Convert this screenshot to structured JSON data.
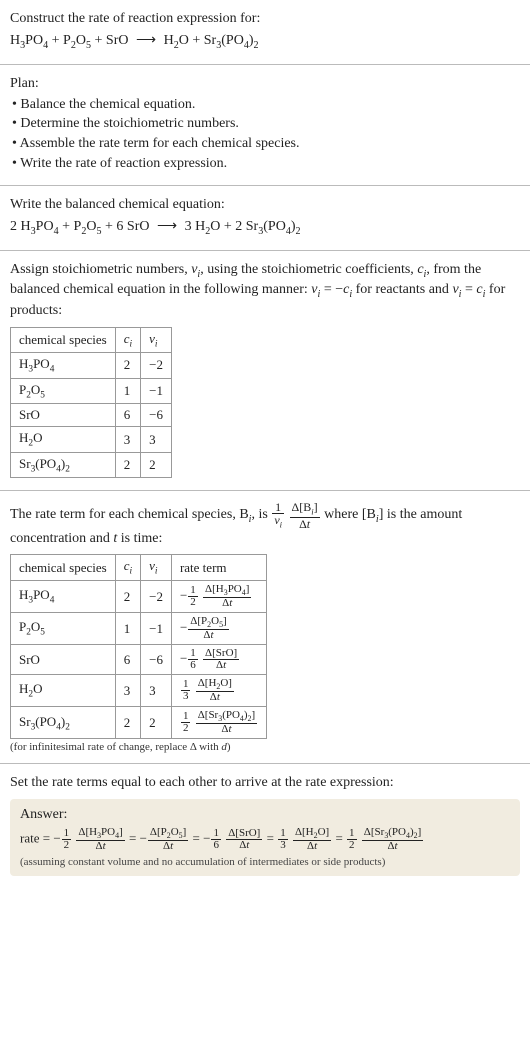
{
  "intro": {
    "title": "Construct the rate of reaction expression for:",
    "equation_html": "H<span class='sub'>3</span>PO<span class='sub'>4</span> + P<span class='sub'>2</span>O<span class='sub'>5</span> + SrO <span class='arrow'>⟶</span> H<span class='sub'>2</span>O + Sr<span class='sub'>3</span>(PO<span class='sub'>4</span>)<span class='sub'>2</span>"
  },
  "plan": {
    "title": "Plan:",
    "items": [
      "• Balance the chemical equation.",
      "• Determine the stoichiometric numbers.",
      "• Assemble the rate term for each chemical species.",
      "• Write the rate of reaction expression."
    ]
  },
  "balanced": {
    "title": "Write the balanced chemical equation:",
    "equation_html": "2 H<span class='sub'>3</span>PO<span class='sub'>4</span> + P<span class='sub'>2</span>O<span class='sub'>5</span> + 6 SrO <span class='arrow'>⟶</span> 3 H<span class='sub'>2</span>O + 2 Sr<span class='sub'>3</span>(PO<span class='sub'>4</span>)<span class='sub'>2</span>"
  },
  "stoich": {
    "intro_html": "Assign stoichiometric numbers, <span class='ital'>ν<span class='sub'>i</span></span>, using the stoichiometric coefficients, <span class='ital'>c<span class='sub'>i</span></span>, from the balanced chemical equation in the following manner: <span class='ital'>ν<span class='sub'>i</span></span> = −<span class='ital'>c<span class='sub'>i</span></span> for reactants and <span class='ital'>ν<span class='sub'>i</span></span> = <span class='ital'>c<span class='sub'>i</span></span> for products:",
    "headers": {
      "species": "chemical species",
      "ci_html": "<span class='ital'>c<span class='sub'>i</span></span>",
      "vi_html": "<span class='ital'>ν<span class='sub'>i</span></span>"
    },
    "rows": [
      {
        "species_html": "H<span class='sub'>3</span>PO<span class='sub'>4</span>",
        "c": "2",
        "v": "−2"
      },
      {
        "species_html": "P<span class='sub'>2</span>O<span class='sub'>5</span>",
        "c": "1",
        "v": "−1"
      },
      {
        "species_html": "SrO",
        "c": "6",
        "v": "−6"
      },
      {
        "species_html": "H<span class='sub'>2</span>O",
        "c": "3",
        "v": "3"
      },
      {
        "species_html": "Sr<span class='sub'>3</span>(PO<span class='sub'>4</span>)<span class='sub'>2</span>",
        "c": "2",
        "v": "2"
      }
    ]
  },
  "rateterm": {
    "intro_html": "The rate term for each chemical species, B<span class='sub ital'>i</span>, is <span class='frac'><span class='num'>1</span><span class='den ital'>ν<span class='sub'>i</span></span></span> <span class='frac'><span class='num'>Δ[B<span class='sub ital'>i</span>]</span><span class='den'>Δ<span class='ital'>t</span></span></span> where [B<span class='sub ital'>i</span>] is the amount concentration and <span class='ital'>t</span> is time:",
    "headers": {
      "species": "chemical species",
      "ci_html": "<span class='ital'>c<span class='sub'>i</span></span>",
      "vi_html": "<span class='ital'>ν<span class='sub'>i</span></span>",
      "rate": "rate term"
    },
    "rows": [
      {
        "species_html": "H<span class='sub'>3</span>PO<span class='sub'>4</span>",
        "c": "2",
        "v": "−2",
        "rate_html": "−<span class='frac sfrac'><span class='num'>1</span><span class='den'>2</span></span> <span class='frac sfrac'><span class='num'>Δ[H<span class='sub'>3</span>PO<span class='sub'>4</span>]</span><span class='den'>Δ<span class='ital'>t</span></span></span>"
      },
      {
        "species_html": "P<span class='sub'>2</span>O<span class='sub'>5</span>",
        "c": "1",
        "v": "−1",
        "rate_html": "−<span class='frac sfrac'><span class='num'>Δ[P<span class='sub'>2</span>O<span class='sub'>5</span>]</span><span class='den'>Δ<span class='ital'>t</span></span></span>"
      },
      {
        "species_html": "SrO",
        "c": "6",
        "v": "−6",
        "rate_html": "−<span class='frac sfrac'><span class='num'>1</span><span class='den'>6</span></span> <span class='frac sfrac'><span class='num'>Δ[SrO]</span><span class='den'>Δ<span class='ital'>t</span></span></span>"
      },
      {
        "species_html": "H<span class='sub'>2</span>O",
        "c": "3",
        "v": "3",
        "rate_html": "<span class='frac sfrac'><span class='num'>1</span><span class='den'>3</span></span> <span class='frac sfrac'><span class='num'>Δ[H<span class='sub'>2</span>O]</span><span class='den'>Δ<span class='ital'>t</span></span></span>"
      },
      {
        "species_html": "Sr<span class='sub'>3</span>(PO<span class='sub'>4</span>)<span class='sub'>2</span>",
        "c": "2",
        "v": "2",
        "rate_html": "<span class='frac sfrac'><span class='num'>1</span><span class='den'>2</span></span> <span class='frac sfrac'><span class='num'>Δ[Sr<span class='sub'>3</span>(PO<span class='sub'>4</span>)<span class='sub'>2</span>]</span><span class='den'>Δ<span class='ital'>t</span></span></span>"
      }
    ],
    "footnote_html": "(for infinitesimal rate of change, replace Δ with <span class='ital'>d</span>)"
  },
  "final": {
    "intro": "Set the rate terms equal to each other to arrive at the rate expression:",
    "answer_title": "Answer:",
    "answer_html": "rate = −<span class='frac sfrac'><span class='num'>1</span><span class='den'>2</span></span> <span class='frac sfrac'><span class='num'>Δ[H<span class='sub'>3</span>PO<span class='sub'>4</span>]</span><span class='den'>Δ<span class='ital'>t</span></span></span> = −<span class='frac sfrac'><span class='num'>Δ[P<span class='sub'>2</span>O<span class='sub'>5</span>]</span><span class='den'>Δ<span class='ital'>t</span></span></span> = −<span class='frac sfrac'><span class='num'>1</span><span class='den'>6</span></span> <span class='frac sfrac'><span class='num'>Δ[SrO]</span><span class='den'>Δ<span class='ital'>t</span></span></span> = <span class='frac sfrac'><span class='num'>1</span><span class='den'>3</span></span> <span class='frac sfrac'><span class='num'>Δ[H<span class='sub'>2</span>O]</span><span class='den'>Δ<span class='ital'>t</span></span></span> = <span class='frac sfrac'><span class='num'>1</span><span class='den'>2</span></span> <span class='frac sfrac'><span class='num'>Δ[Sr<span class='sub'>3</span>(PO<span class='sub'>4</span>)<span class='sub'>2</span>]</span><span class='den'>Δ<span class='ital'>t</span></span></span>",
    "answer_note": "(assuming constant volume and no accumulation of intermediates or side products)"
  }
}
